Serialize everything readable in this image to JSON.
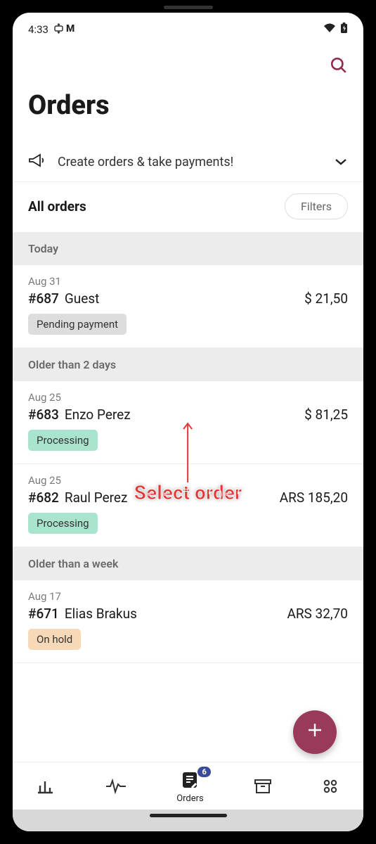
{
  "status_bar": {
    "time": "4:33",
    "left_icons": [
      "sync-icon",
      "m-icon"
    ],
    "right_icons": [
      "wifi-icon",
      "battery-icon"
    ]
  },
  "header": {
    "title": "Orders"
  },
  "banner": {
    "text": "Create orders & take payments!"
  },
  "filter": {
    "scope_label": "All orders",
    "filters_button": "Filters"
  },
  "sections": [
    {
      "label": "Today",
      "orders": [
        {
          "date": "Aug 31",
          "id": "#687",
          "name": "Guest",
          "amount": "$ 21,50",
          "status": "Pending payment",
          "status_kind": "pending"
        }
      ]
    },
    {
      "label": "Older than 2 days",
      "orders": [
        {
          "date": "Aug 25",
          "id": "#683",
          "name": "Enzo Perez",
          "amount": "$ 81,25",
          "status": "Processing",
          "status_kind": "processing"
        },
        {
          "date": "Aug 25",
          "id": "#682",
          "name": "Raul Perez",
          "amount": "ARS 185,20",
          "status": "Processing",
          "status_kind": "processing"
        }
      ]
    },
    {
      "label": "Older than a week",
      "orders": [
        {
          "date": "Aug 17",
          "id": "#671",
          "name": "Elias Brakus",
          "amount": "ARS 32,70",
          "status": "On hold",
          "status_kind": "onhold"
        }
      ]
    }
  ],
  "annotation": {
    "text": "Select order"
  },
  "bottom_nav": {
    "items": [
      {
        "name": "stats",
        "label": ""
      },
      {
        "name": "activity",
        "label": ""
      },
      {
        "name": "orders",
        "label": "Orders",
        "badge": "6",
        "active": true
      },
      {
        "name": "archive",
        "label": ""
      },
      {
        "name": "apps",
        "label": ""
      }
    ]
  },
  "colors": {
    "accent": "#9a3a5a",
    "badge": "#3a4a9a",
    "annotation": "#e03a3a"
  }
}
